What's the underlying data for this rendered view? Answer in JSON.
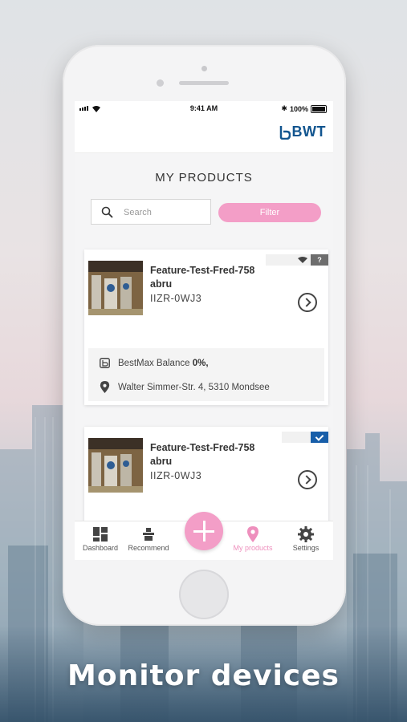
{
  "caption": "Monitor devices",
  "status_bar": {
    "time": "9:41 AM",
    "battery": "100%"
  },
  "brand": {
    "logo_text": "BWT",
    "color": "#12558f"
  },
  "page": {
    "title": "MY PRODUCTS"
  },
  "search": {
    "placeholder": "Search"
  },
  "filter": {
    "label": "Filter",
    "color": "#f39ec7"
  },
  "products": [
    {
      "name": "Feature-Test-Fred-758 abru",
      "serial": "IIZR-0WJ3",
      "badges": [
        "wifi-icon",
        "?"
      ],
      "info": {
        "device": "BestMax Balance",
        "level": "0%,",
        "address": "Walter Simmer-Str. 4, 5310 Mondsee"
      }
    },
    {
      "name": "Feature-Test-Fred-758 abru",
      "serial": "IIZR-0WJ3",
      "badges": [
        "check-icon"
      ]
    }
  ],
  "tabbar": {
    "items": [
      {
        "label": "Dashboard",
        "icon": "dashboard-icon"
      },
      {
        "label": "Recommend",
        "icon": "recommend-icon"
      },
      {
        "label": "",
        "icon": "add-icon"
      },
      {
        "label": "My products",
        "icon": "location-pin-icon",
        "active": true
      },
      {
        "label": "Settings",
        "icon": "gear-icon"
      }
    ],
    "active_color": "#ee8fbd"
  }
}
